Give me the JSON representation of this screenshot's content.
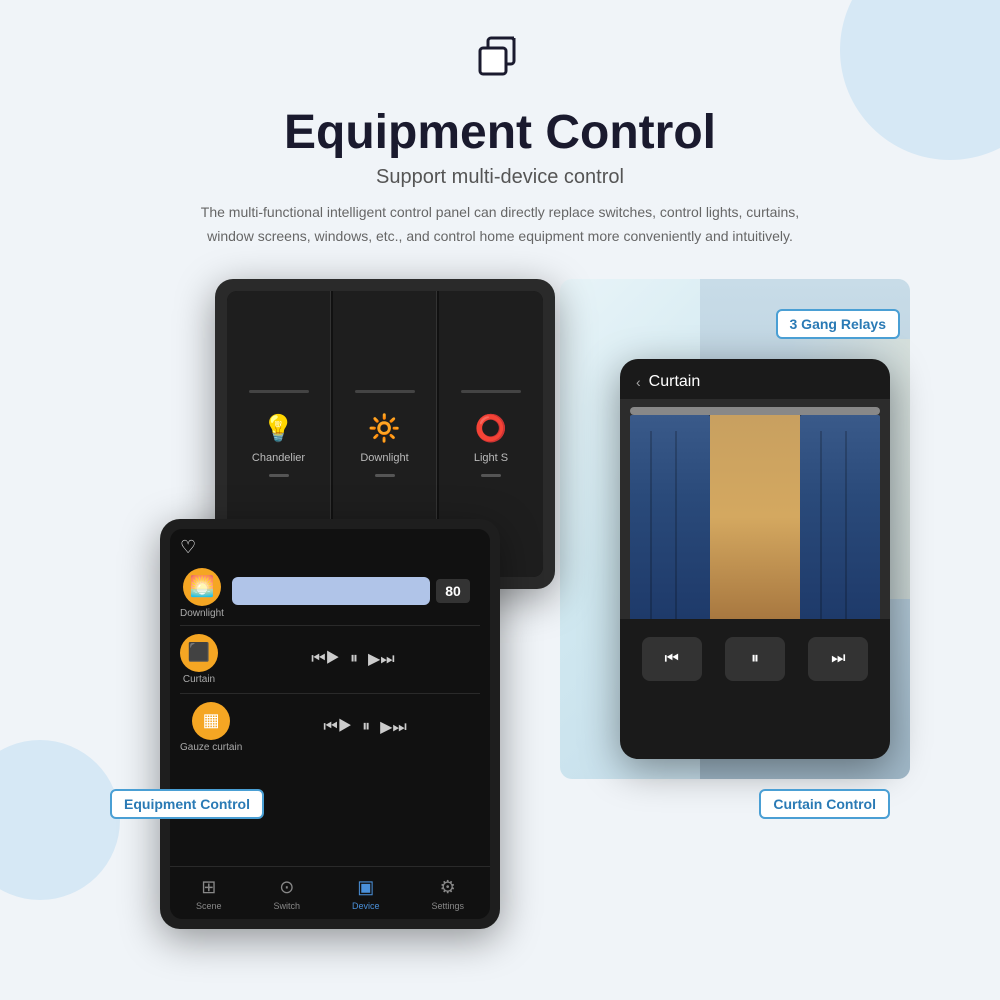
{
  "header": {
    "icon_label": "copy-layers-icon",
    "title": "Equipment Control",
    "subtitle": "Support multi-device control",
    "description": "The multi-functional intelligent control panel can directly replace switches, control lights, curtains, window screens, windows, etc., and control home equipment more conveniently and intuitively."
  },
  "callouts": {
    "relay": "3 Gang Relays",
    "equipment": "Equipment Control",
    "curtain": "Curtain Control"
  },
  "back_panel": {
    "cells": [
      {
        "label": "Chandelier",
        "icon": "💡"
      },
      {
        "label": "Downlight",
        "icon": "🔆"
      },
      {
        "label": "Light S",
        "icon": "⭕"
      }
    ]
  },
  "curtain_panel": {
    "back_label": "Curtain",
    "controls": [
      "⏮",
      "⏸",
      "⏭"
    ]
  },
  "main_panel": {
    "devices": [
      {
        "name": "Downlight",
        "icon": "🌅",
        "brightness": 80,
        "brightness_label": "80"
      },
      {
        "name": "Curtain",
        "icon": "🪟",
        "controls": [
          "⏮|⏭",
          "|",
          "⏭|⏮"
        ]
      },
      {
        "name": "Gauze curtain",
        "icon": "🪟",
        "controls": [
          "⏮|⏭",
          "|",
          "⏭|⏮"
        ]
      }
    ],
    "nav": [
      {
        "label": "Scene",
        "icon": "⊞",
        "active": false
      },
      {
        "label": "Switch",
        "icon": "⊙",
        "active": false
      },
      {
        "label": "Device",
        "icon": "📱",
        "active": true
      },
      {
        "label": "Settings",
        "icon": "⚙",
        "active": false
      }
    ]
  }
}
